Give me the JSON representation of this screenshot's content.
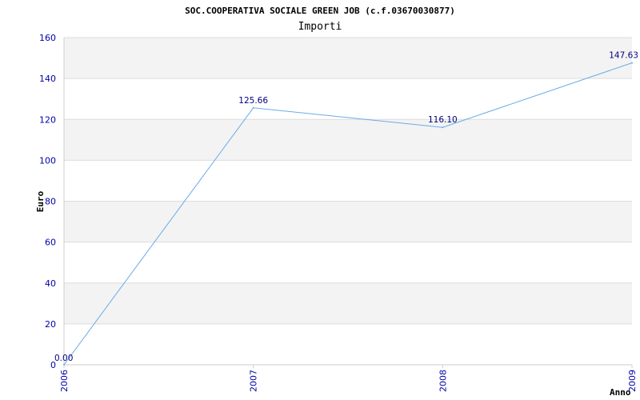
{
  "chart_data": {
    "type": "line",
    "title": "SOC.COOPERATIVA SOCIALE GREEN JOB (c.f.03670030877)",
    "subtitle": "Importi",
    "ylabel": "Euro",
    "xlabel": "Anno",
    "categories": [
      "2006",
      "2007",
      "2008",
      "2009"
    ],
    "values": [
      0.0,
      125.66,
      116.1,
      147.63
    ],
    "data_labels": [
      "0.00",
      "125.66",
      "116.10",
      "147.63"
    ],
    "ylim": [
      0,
      160
    ],
    "yticks": [
      "0",
      "20",
      "40",
      "60",
      "80",
      "100",
      "120",
      "140",
      "160"
    ],
    "line_color": "#6aaae8",
    "band_color": "#f3f3f3",
    "grid": true
  }
}
